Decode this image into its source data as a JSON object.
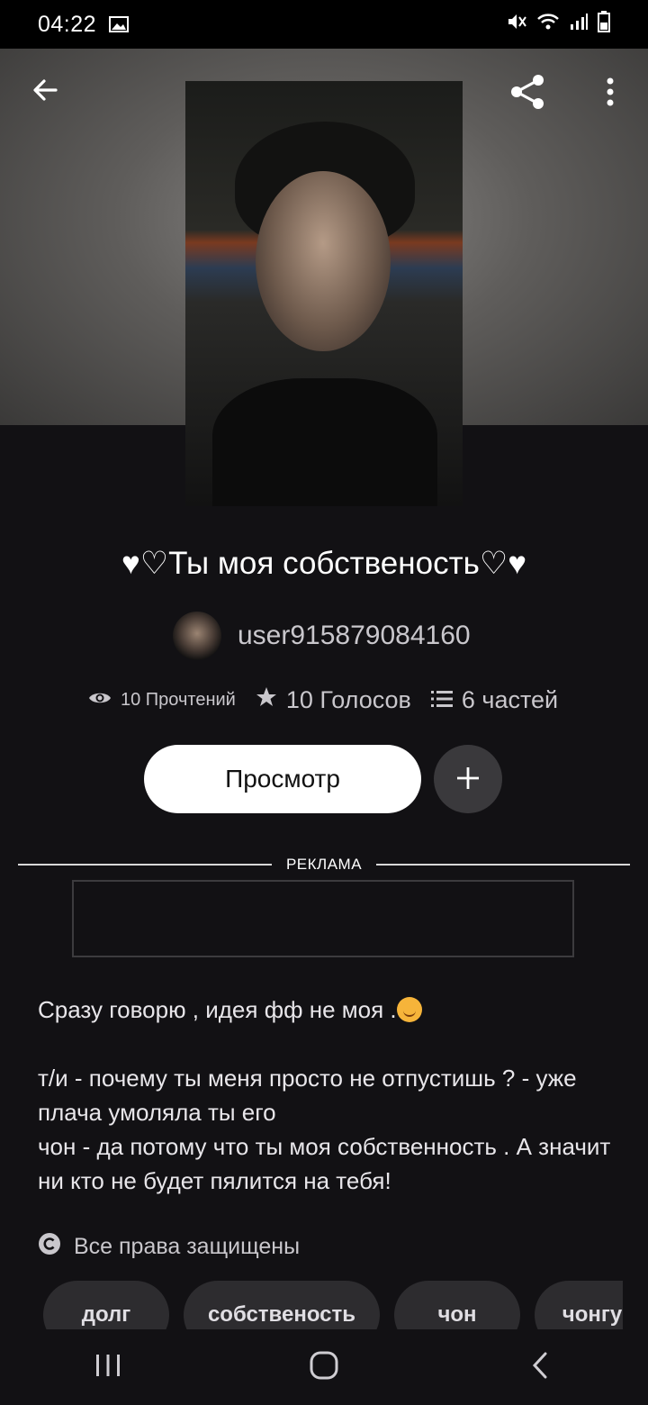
{
  "status_bar": {
    "time": "04:22",
    "icons": [
      "image-icon",
      "mute-icon",
      "wifi-icon",
      "signal-icon",
      "battery-icon"
    ]
  },
  "header": {
    "back_icon": "arrow-left-icon",
    "share_icon": "share-icon",
    "more_icon": "more-vertical-icon"
  },
  "story": {
    "title": "♥♡Ты моя собственость♡♥",
    "author": "user915879084160",
    "reads": "10 Прочтений",
    "votes": "10 Голосов",
    "parts": "6 частей"
  },
  "actions": {
    "view_label": "Просмотр",
    "add_icon": "plus-icon"
  },
  "ad": {
    "label": "РЕКЛАМА"
  },
  "description": {
    "line1": "Сразу говорю , идея фф не моя .",
    "para2": "т/и - почему ты меня просто не отпустишь ? - уже плача умоляла ты его",
    "para3": "чон - да потому что ты моя собственность . А значит ни кто не будет пялится на тебя!"
  },
  "rights": {
    "text": "Все права защищены"
  },
  "tags": [
    "долг",
    "собственость",
    "чон",
    "чонгук"
  ],
  "colors": {
    "background": "#121114",
    "button_primary": "#ffffff",
    "button_secondary": "#3a393c",
    "tag_bg": "#2d2c2f"
  }
}
